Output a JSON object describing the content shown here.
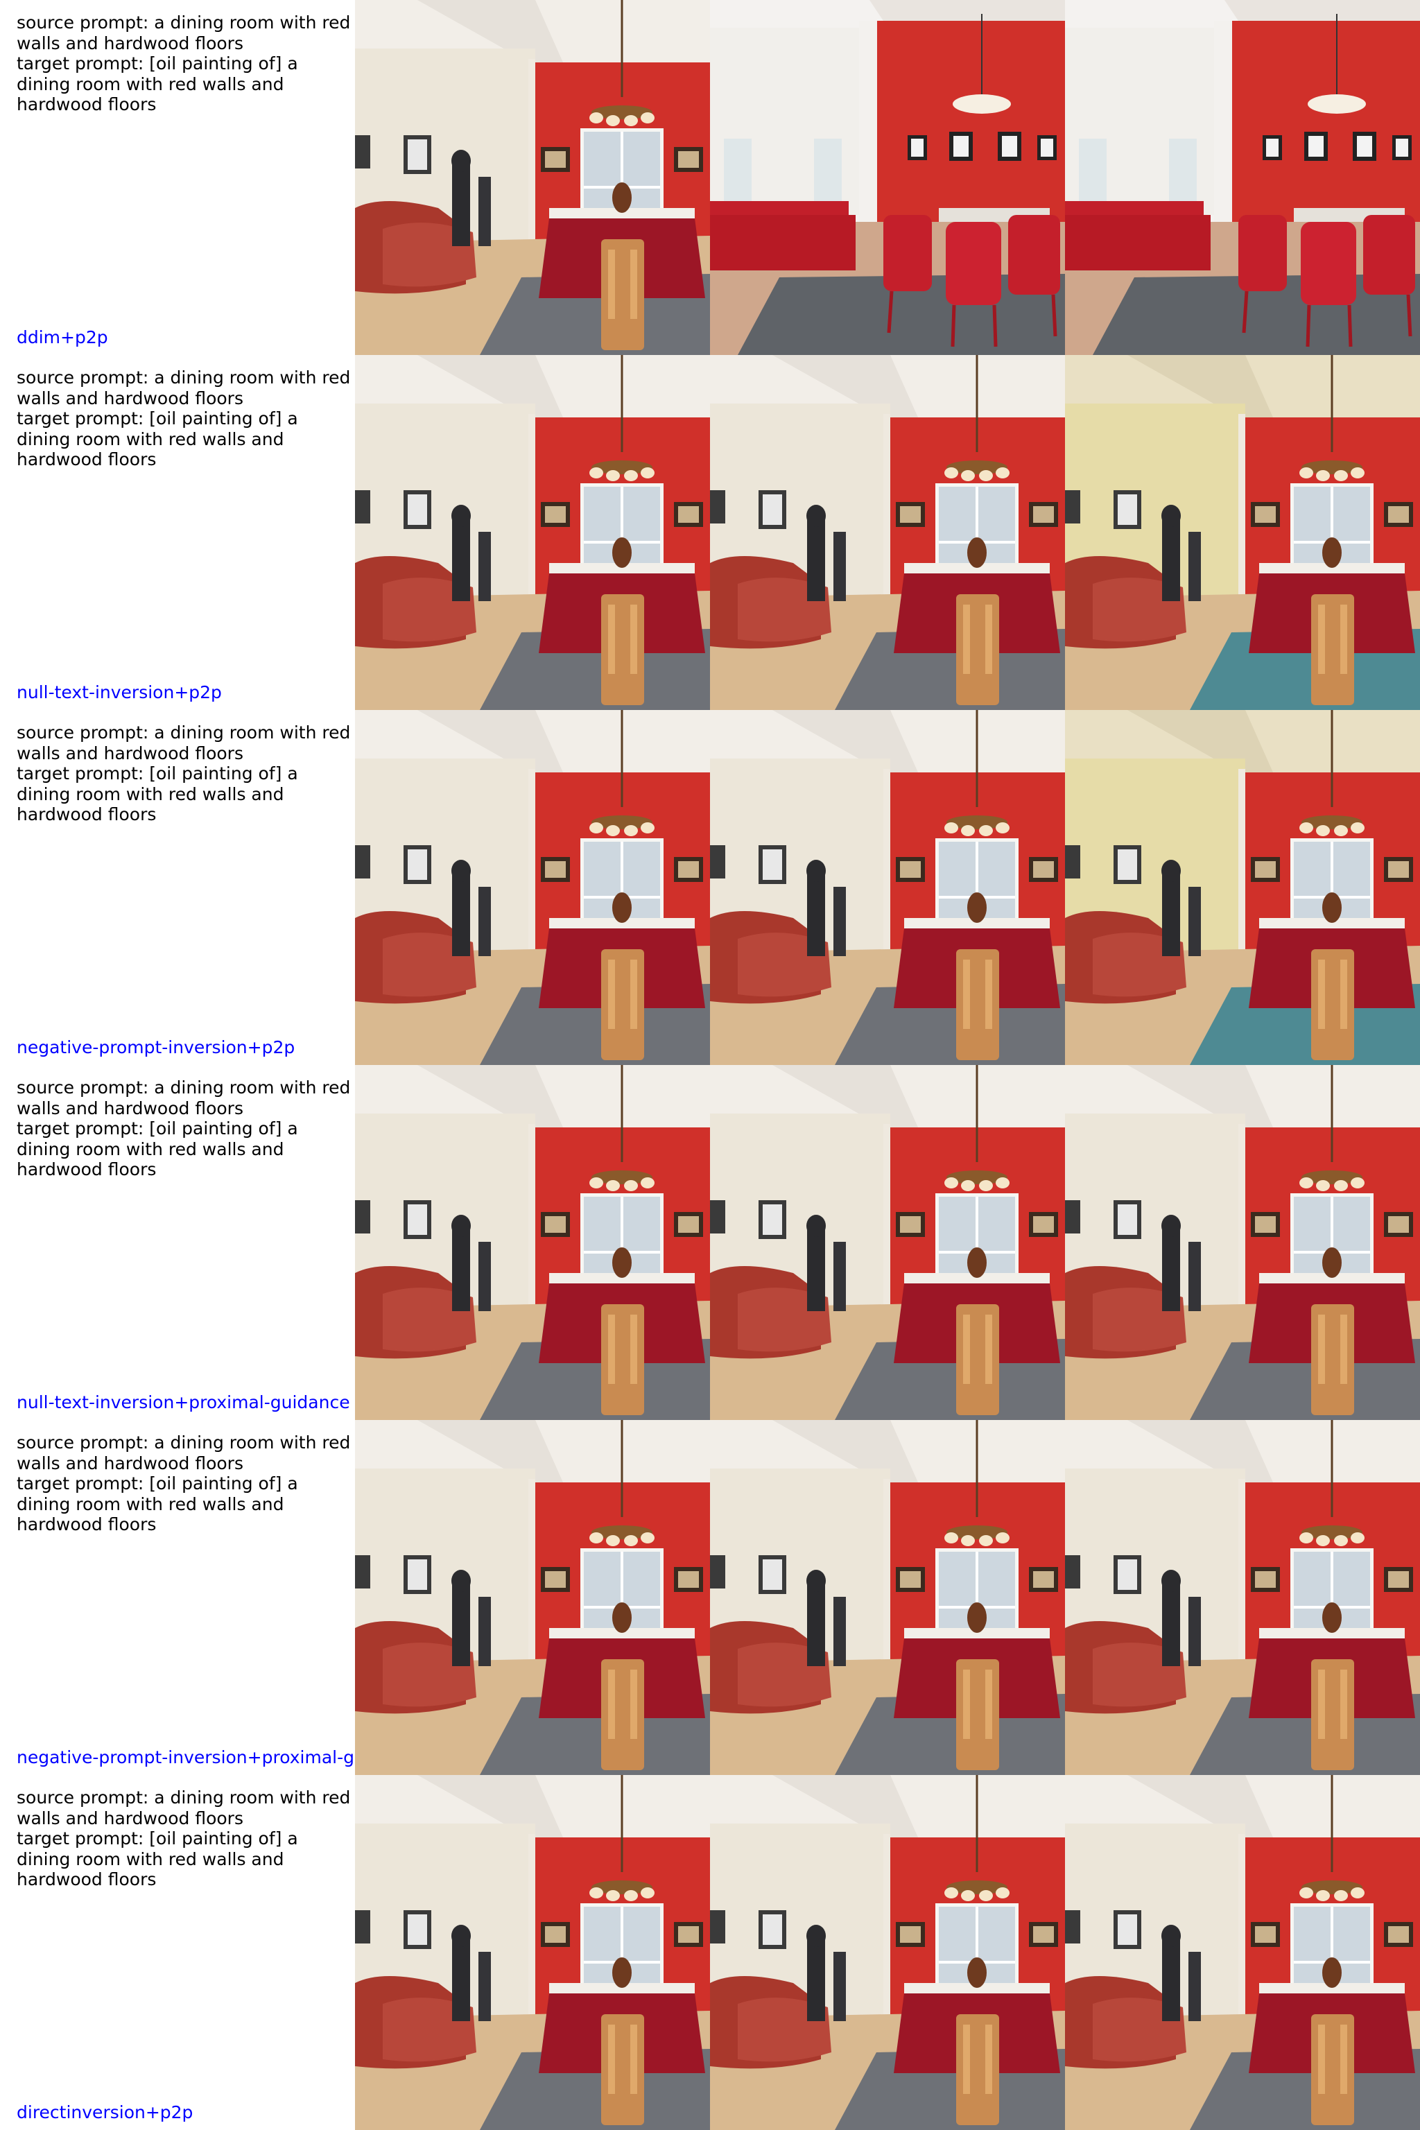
{
  "rows": [
    {
      "prompt": "source prompt: a dining room with red\nwalls and hardwood floors\ntarget prompt: [oil painting of] a\ndining room with red walls and\nhardwood floors",
      "method": "ddim+p2p",
      "images": [
        {
          "variant": "source",
          "painted": false
        },
        {
          "variant": "reconstruction-open-plan",
          "painted": false
        },
        {
          "variant": "edit-open-plan",
          "painted": false
        }
      ]
    },
    {
      "prompt": "source prompt: a dining room with red\nwalls and hardwood floors\ntarget prompt: [oil painting of] a\ndining room with red walls and\nhardwood floors",
      "method": "null-text-inversion+p2p",
      "images": [
        {
          "variant": "source",
          "painted": false
        },
        {
          "variant": "reconstruction",
          "painted": false
        },
        {
          "variant": "edit-oil-painting",
          "painted": true
        }
      ]
    },
    {
      "prompt": "source prompt: a dining room with red\nwalls and hardwood floors\ntarget prompt: [oil painting of] a\ndining room with red walls and\nhardwood floors",
      "method": "negative-prompt-inversion+p2p",
      "images": [
        {
          "variant": "source",
          "painted": false
        },
        {
          "variant": "reconstruction",
          "painted": false
        },
        {
          "variant": "edit-oil-painting",
          "painted": true
        }
      ]
    },
    {
      "prompt": "source prompt: a dining room with red\nwalls and hardwood floors\ntarget prompt: [oil painting of] a\ndining room with red walls and\nhardwood floors",
      "method": "null-text-inversion+proximal-guidance",
      "images": [
        {
          "variant": "source",
          "painted": false
        },
        {
          "variant": "reconstruction",
          "painted": false
        },
        {
          "variant": "edit",
          "painted": false
        }
      ]
    },
    {
      "prompt": "source prompt: a dining room with red\nwalls and hardwood floors\ntarget prompt: [oil painting of] a\ndining room with red walls and\nhardwood floors",
      "method": "negative-prompt-inversion+proximal-g",
      "images": [
        {
          "variant": "source",
          "painted": false
        },
        {
          "variant": "reconstruction",
          "painted": false
        },
        {
          "variant": "edit",
          "painted": false
        }
      ]
    },
    {
      "prompt": "source prompt: a dining room with red\nwalls and hardwood floors\ntarget prompt: [oil painting of] a\ndining room with red walls and\nhardwood floors",
      "method": "directinversion+p2p",
      "images": [
        {
          "variant": "source",
          "painted": false
        },
        {
          "variant": "reconstruction",
          "painted": false
        },
        {
          "variant": "edit",
          "painted": false
        }
      ]
    }
  ],
  "colors": {
    "prompt_text": "#000000",
    "method_label": "#0000ff",
    "red_wall": "#d0302a",
    "cream_wall": "#ece6d9",
    "wood_floor": "#d9b990",
    "rug": "#6e7177",
    "sofa": "#a9382c",
    "tablecloth": "#9c1626",
    "painted_wall": "#e6dca8",
    "painted_rug": "#4e8a93"
  }
}
